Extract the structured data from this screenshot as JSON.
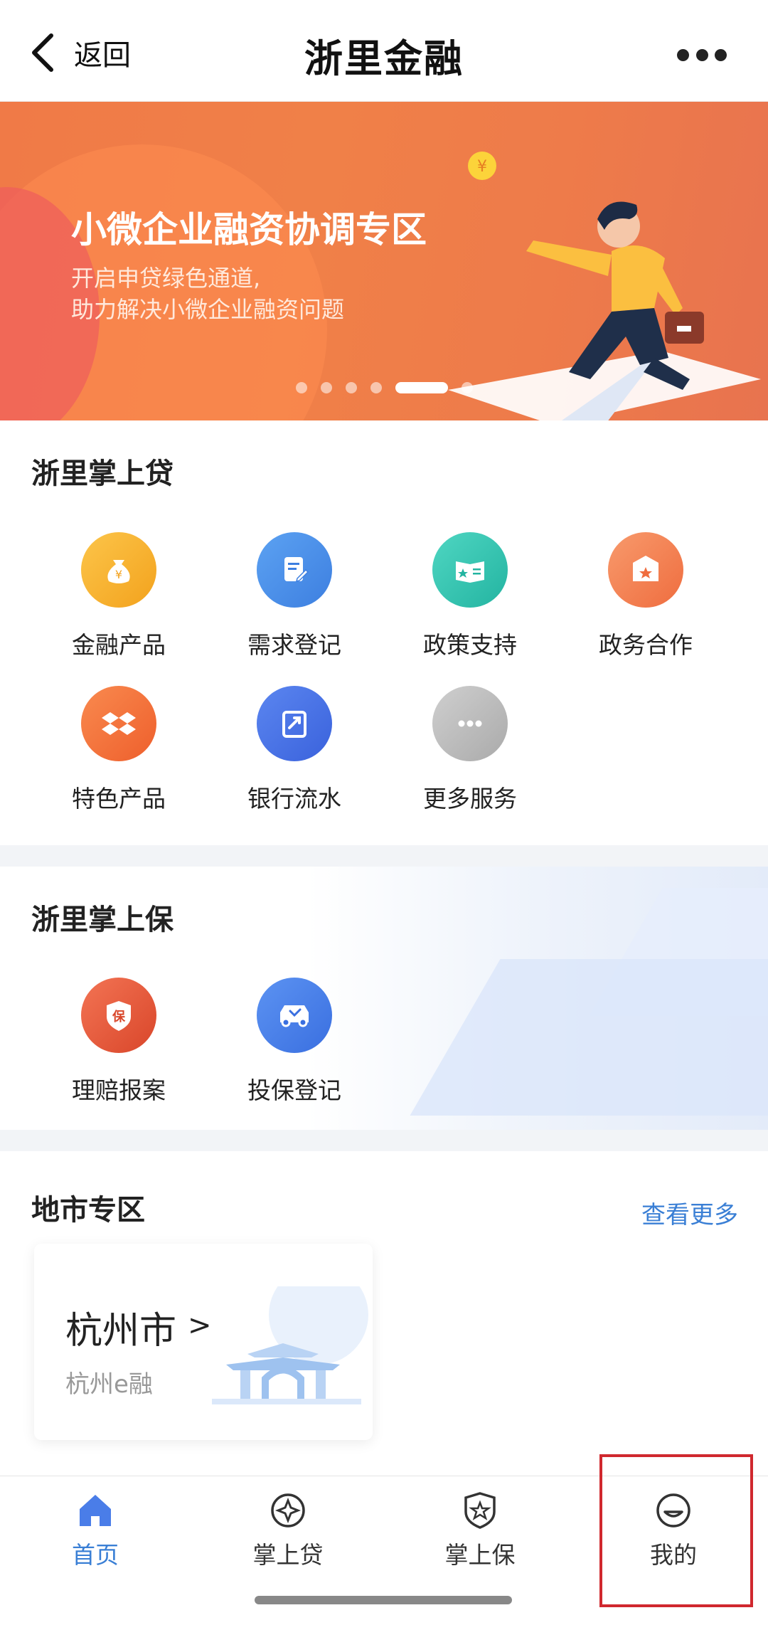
{
  "header": {
    "back_label": "返回",
    "title": "浙里金融"
  },
  "banner": {
    "title": "小微企业融资协调专区",
    "subtitle_line1": "开启申贷绿色通道,",
    "subtitle_line2": "助力解决小微企业融资问题",
    "page_count": 6,
    "active_page": 5
  },
  "loan_section": {
    "title": "浙里掌上贷",
    "items": [
      {
        "label": "金融产品",
        "icon": "money-bag-icon",
        "color": "#f5a623"
      },
      {
        "label": "需求登记",
        "icon": "register-form-icon",
        "color": "#4a90e8"
      },
      {
        "label": "政策支持",
        "icon": "policy-book-icon",
        "color": "#2fc3b0"
      },
      {
        "label": "政务合作",
        "icon": "government-badge-icon",
        "color": "#f37b4d"
      },
      {
        "label": "特色产品",
        "icon": "feature-box-icon",
        "color": "#f07033"
      },
      {
        "label": "银行流水",
        "icon": "bank-statement-icon",
        "color": "#4a72e8"
      },
      {
        "label": "更多服务",
        "icon": "more-dots-icon",
        "color": "#b8b8b8"
      }
    ]
  },
  "insurance_section": {
    "title": "浙里掌上保",
    "items": [
      {
        "label": "理赔报案",
        "icon": "claim-shield-icon",
        "color": "#e5563a",
        "glyph": "保"
      },
      {
        "label": "投保登记",
        "icon": "car-insurance-icon",
        "color": "#4a7de8"
      }
    ]
  },
  "city_section": {
    "title": "地市专区",
    "more_label": "查看更多",
    "card": {
      "name": "杭州市",
      "arrow": ">",
      "subtitle": "杭州e融"
    }
  },
  "bottom_nav": {
    "items": [
      {
        "label": "首页",
        "icon": "home-icon",
        "active": true
      },
      {
        "label": "掌上贷",
        "icon": "loan-compass-icon",
        "active": false
      },
      {
        "label": "掌上保",
        "icon": "insurance-star-icon",
        "active": false
      },
      {
        "label": "我的",
        "icon": "profile-face-icon",
        "active": false
      }
    ]
  },
  "colors": {
    "accent_blue": "#3a7fd5",
    "banner_orange": "#f07a47",
    "highlight_red": "#d0282e"
  }
}
